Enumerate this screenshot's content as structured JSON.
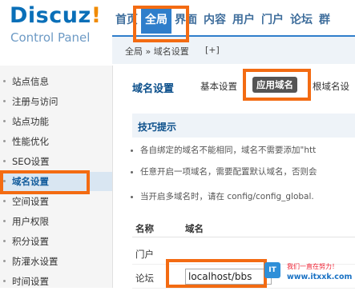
{
  "header": {
    "logo": "Discuz",
    "logo_bang": "!",
    "subtitle": "Control Panel"
  },
  "topnav": {
    "items": [
      "首页",
      "全局",
      "界面",
      "内容",
      "用户",
      "门户",
      "论坛",
      "群"
    ],
    "active_index": 1
  },
  "breadcrumb": {
    "path": "全局 » 域名设置",
    "add": "[+]"
  },
  "sidebar": {
    "items": [
      {
        "label": "站点信息"
      },
      {
        "label": "注册与访问"
      },
      {
        "label": "站点功能"
      },
      {
        "label": "性能优化"
      },
      {
        "label": "SEO设置"
      },
      {
        "label": "域名设置"
      },
      {
        "label": "空间设置"
      },
      {
        "label": "用户权限"
      },
      {
        "label": "积分设置"
      },
      {
        "label": "防灌水设置"
      },
      {
        "label": "时间设置"
      }
    ],
    "active_index": 5
  },
  "main": {
    "title": "域名设置",
    "tabs": [
      "基本设置",
      "应用域名",
      "根域名设"
    ],
    "active_tab": 1,
    "tips_title": "技巧提示",
    "tips": [
      "各自绑定的域名不能相同，域名不需要添加\"htt",
      "任意开启一项域名，需要配置默认域名，否则会",
      "当开启多域名时，请在 config/config_global."
    ],
    "columns": [
      "名称",
      "域名"
    ],
    "rows": [
      {
        "name": "门户",
        "domain": ""
      },
      {
        "name": "论坛",
        "domain": "localhost/bbs"
      }
    ]
  },
  "watermark": {
    "line1": "我们一直在努力！",
    "line2": "www.itxxk.com"
  },
  "colors": {
    "accent": "#2f7ecb",
    "highlight": "#f36b12",
    "logo": "#0a6fb8"
  }
}
